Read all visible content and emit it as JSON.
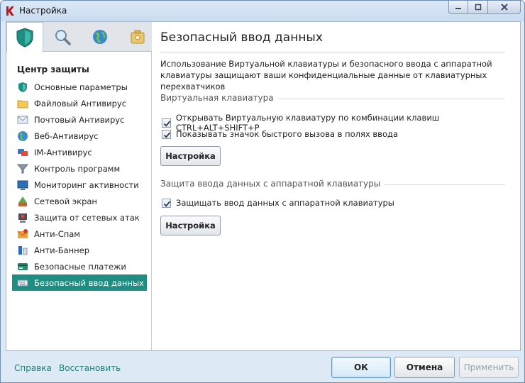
{
  "window": {
    "title": "Настройка"
  },
  "tabs": [
    {
      "icon": "shield-icon"
    },
    {
      "icon": "magnifier-icon"
    },
    {
      "icon": "globe-update-icon"
    },
    {
      "icon": "safe-box-icon"
    }
  ],
  "sidebar": {
    "section_title": "Центр защиты",
    "items": [
      {
        "label": "Основные параметры",
        "icon": "shield-small-icon"
      },
      {
        "label": "Файловый Антивирус",
        "icon": "folder-icon"
      },
      {
        "label": "Почтовый Антивирус",
        "icon": "envelope-icon"
      },
      {
        "label": "Веб-Антивирус",
        "icon": "globe-icon"
      },
      {
        "label": "IM-Антивирус",
        "icon": "chat-icon"
      },
      {
        "label": "Контроль программ",
        "icon": "filter-icon"
      },
      {
        "label": "Мониторинг активности",
        "icon": "monitor-icon"
      },
      {
        "label": "Сетевой экран",
        "icon": "firewall-icon"
      },
      {
        "label": "Защита от сетевых атак",
        "icon": "network-attack-icon"
      },
      {
        "label": "Анти-Спам",
        "icon": "antispam-icon"
      },
      {
        "label": "Анти-Баннер",
        "icon": "antibanner-icon"
      },
      {
        "label": "Безопасные платежи",
        "icon": "payment-card-icon"
      },
      {
        "label": "Безопасный ввод данных",
        "icon": "keyboard-icon",
        "selected": true
      }
    ]
  },
  "main": {
    "title": "Безопасный ввод данных",
    "description": "Использование Виртуальной клавиатуры и безопасного ввода с аппаратной клавиатуры защищают ваши конфиденциальные данные от клавиатурных перехватчиков",
    "virtual_keyboard": {
      "group_label": "Виртуальная клавиатура",
      "option_shortcut": {
        "label": "Открывать Виртуальную клавиатуру по комбинации клавиш CTRL+ALT+SHIFT+P",
        "checked": true
      },
      "option_icon": {
        "label": "Показывать значок быстрого вызова в полях ввода",
        "checked": true
      },
      "settings_button": "Настройка"
    },
    "hardware_keyboard": {
      "group_label": "Защита ввода данных с аппаратной клавиатуры",
      "option_protect": {
        "label": "Защищать ввод данных с аппаратной клавиатуры",
        "checked": true
      },
      "settings_button": "Настройка"
    }
  },
  "footer": {
    "help_link": "Справка",
    "restore_link": "Восстановить",
    "ok_button": "ОК",
    "cancel_button": "Отмена",
    "apply_button": "Применить",
    "apply_enabled": false
  },
  "colors": {
    "accent": "#1e8d82",
    "link": "#1e7f76"
  }
}
